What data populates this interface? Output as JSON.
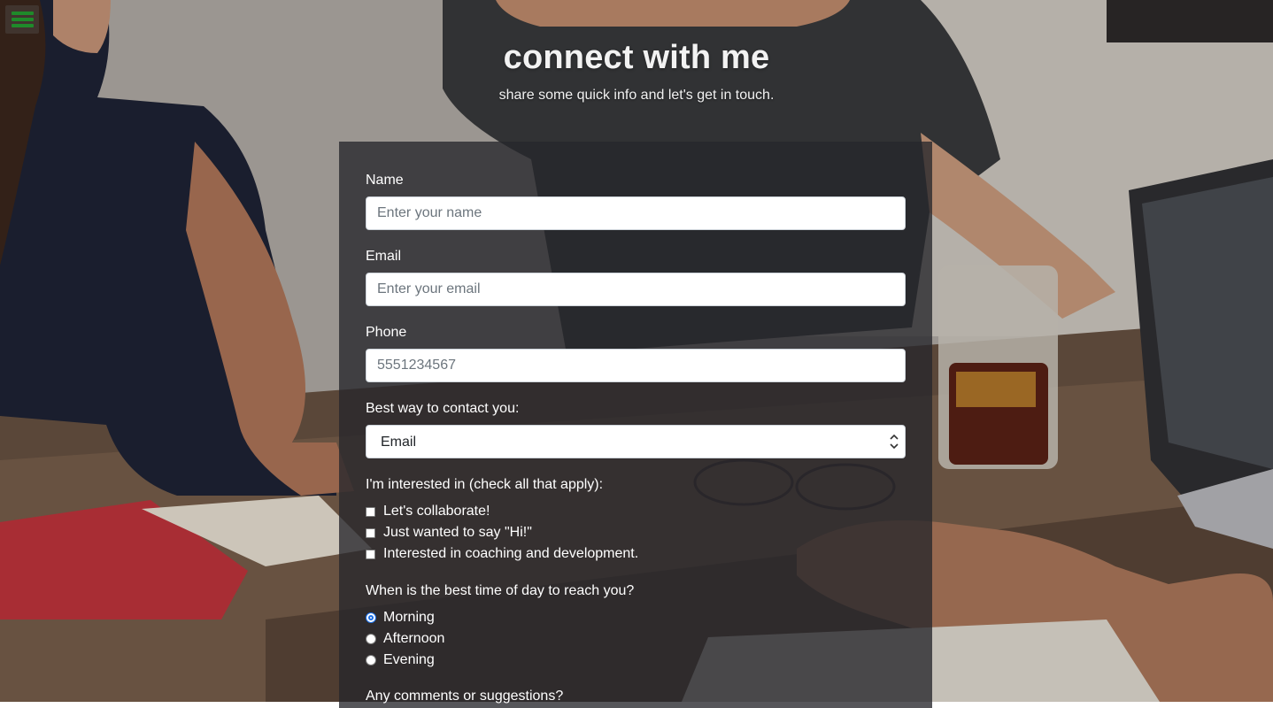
{
  "menu": {
    "icon": "hamburger-icon",
    "icon_color": "#1f8a2a"
  },
  "header": {
    "title": "connect with me",
    "subtitle": "share some quick info and let's get in touch."
  },
  "form": {
    "name": {
      "label": "Name",
      "placeholder": "Enter your name",
      "value": ""
    },
    "email": {
      "label": "Email",
      "placeholder": "Enter your email",
      "value": ""
    },
    "phone": {
      "label": "Phone",
      "placeholder": "5551234567",
      "value": ""
    },
    "contact_method": {
      "label": "Best way to contact you:",
      "selected": "Email"
    },
    "interests": {
      "label": "I'm interested in (check all that apply):",
      "options": [
        {
          "label": "Let's collaborate!",
          "checked": false
        },
        {
          "label": "Just wanted to say \"Hi!\"",
          "checked": false
        },
        {
          "label": "Interested in coaching and development.",
          "checked": false
        }
      ]
    },
    "time_of_day": {
      "label": "When is the best time of day to reach you?",
      "options": [
        {
          "label": "Morning",
          "checked": false,
          "focused": true
        },
        {
          "label": "Afternoon",
          "checked": false
        },
        {
          "label": "Evening",
          "checked": false
        }
      ]
    },
    "comments": {
      "label": "Any comments or suggestions?"
    }
  },
  "colors": {
    "panel": "#26262c",
    "accent_focus": "#1a6fe8",
    "label_text": "#ffffff"
  }
}
